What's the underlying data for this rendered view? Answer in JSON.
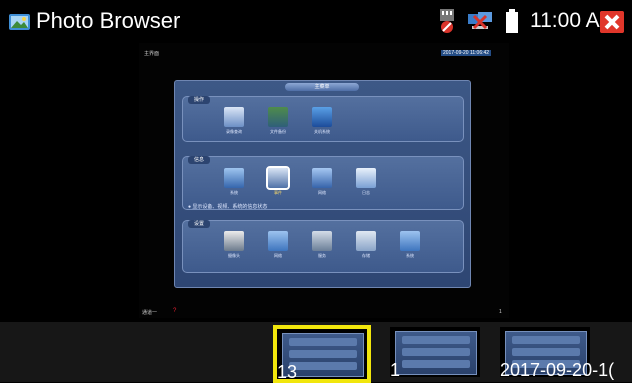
{
  "statusbar": {
    "title": "Photo Browser",
    "time": "11:00 AM",
    "icons": [
      "photo-app-icon",
      "sd-card-icon",
      "network-icon",
      "battery-icon",
      "close-icon"
    ],
    "accent_close": "#e0362a"
  },
  "viewer": {
    "photo": {
      "top_left_text": "主界面",
      "timestamp": "2017-09-20 11:06:42",
      "panel_title": "主菜单",
      "bottom_left_text": "通道一",
      "bottom_red_text": "?",
      "bottom_right_text": "1",
      "sections": [
        {
          "label": "操作",
          "items": [
            "录像查询",
            "文件备份",
            "关机系统"
          ]
        },
        {
          "label": "信息",
          "items": [
            "系统",
            "事件",
            "网络",
            "日志"
          ],
          "note": "● 显示设备、视频、系统的信息状态"
        },
        {
          "label": "设置",
          "items": [
            "摄像头",
            "网络",
            "服务",
            "存储",
            "系统"
          ]
        }
      ]
    }
  },
  "thumbnails": [
    {
      "label": "13",
      "selected": true
    },
    {
      "label": "1",
      "selected": false
    },
    {
      "label": "2017-09-20-1(",
      "selected": false
    }
  ]
}
